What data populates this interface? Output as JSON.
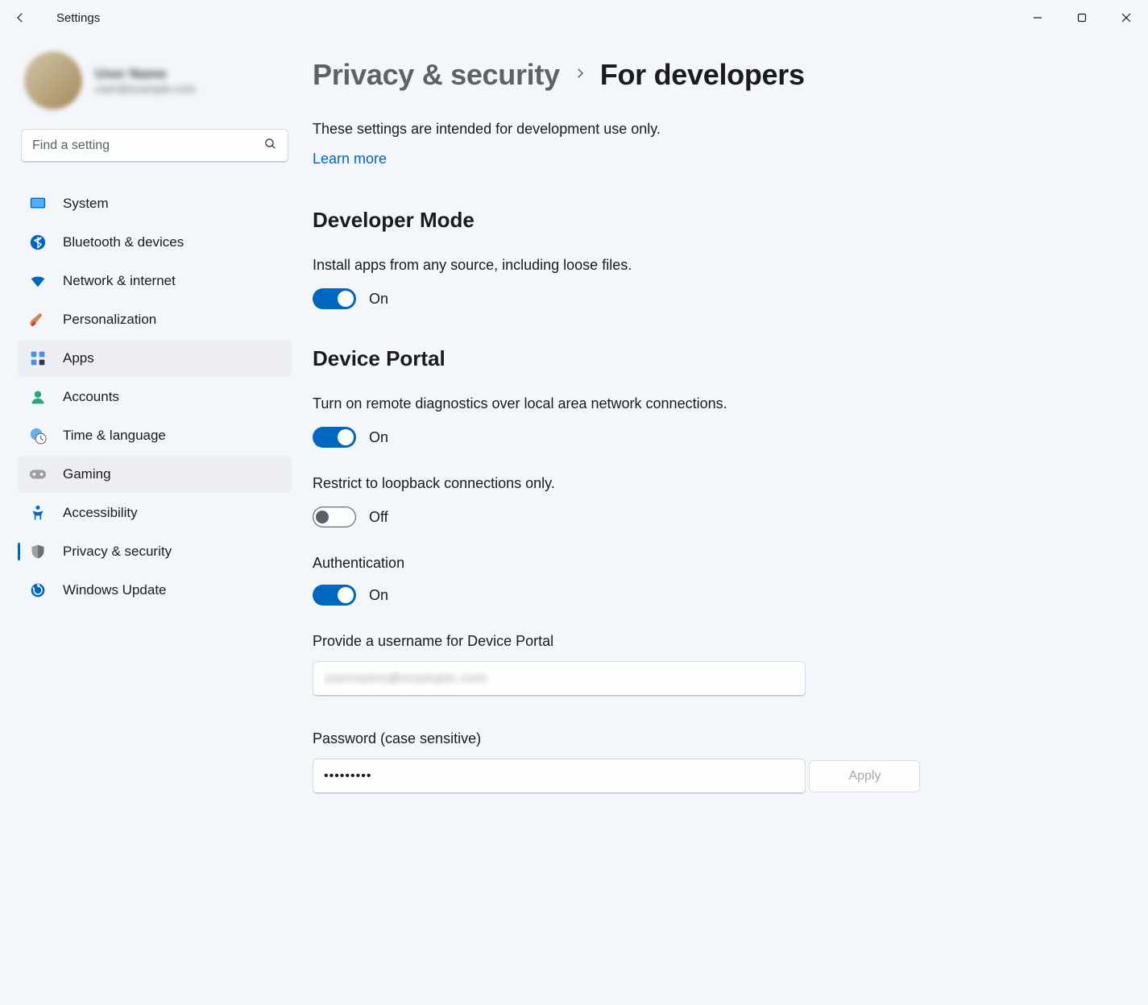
{
  "app_title": "Settings",
  "search": {
    "placeholder": "Find a setting"
  },
  "nav": {
    "items": [
      {
        "label": "System",
        "icon": "display"
      },
      {
        "label": "Bluetooth & devices",
        "icon": "bluetooth"
      },
      {
        "label": "Network & internet",
        "icon": "wifi"
      },
      {
        "label": "Personalization",
        "icon": "brush"
      },
      {
        "label": "Apps",
        "icon": "apps",
        "selected": true
      },
      {
        "label": "Accounts",
        "icon": "person"
      },
      {
        "label": "Time & language",
        "icon": "time"
      },
      {
        "label": "Gaming",
        "icon": "gaming",
        "selected": true
      },
      {
        "label": "Accessibility",
        "icon": "accessibility"
      },
      {
        "label": "Privacy & security",
        "icon": "shield",
        "current": true
      },
      {
        "label": "Windows Update",
        "icon": "update"
      }
    ]
  },
  "breadcrumb": {
    "parent": "Privacy & security",
    "current": "For developers"
  },
  "intro": "These settings are intended for development use only.",
  "learn_more": "Learn more",
  "developer_mode": {
    "title": "Developer Mode",
    "description": "Install apps from any source, including loose files.",
    "toggle_on": true,
    "toggle_label": "On"
  },
  "device_portal": {
    "title": "Device Portal",
    "description": "Turn on remote diagnostics over local area network connections.",
    "main_toggle": {
      "on": true,
      "label": "On"
    },
    "loopback": {
      "description": "Restrict to loopback connections only.",
      "on": false,
      "label": "Off"
    },
    "authentication": {
      "title": "Authentication",
      "on": true,
      "label": "On"
    },
    "username_label": "Provide a username for Device Portal",
    "username_value": "",
    "password_label": "Password (case sensitive)",
    "password_value": "•••••••••",
    "apply_label": "Apply"
  }
}
